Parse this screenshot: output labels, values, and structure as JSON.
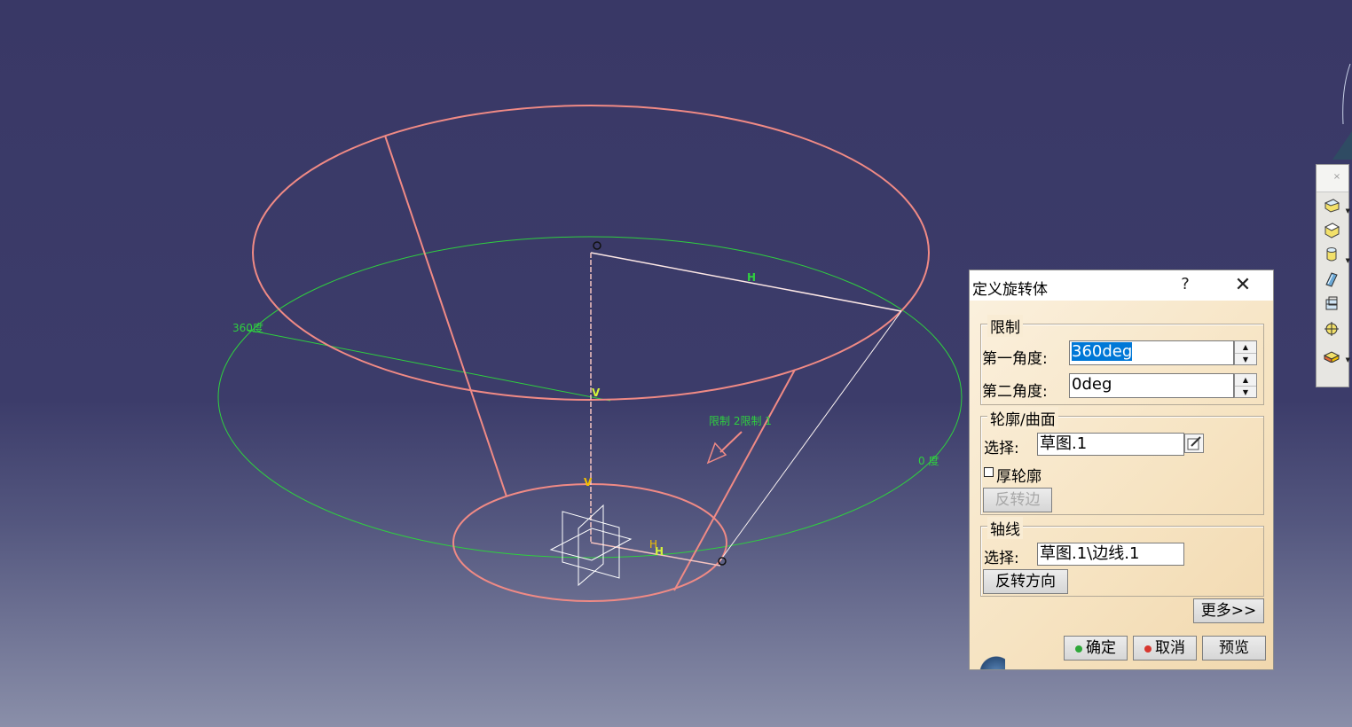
{
  "dialog": {
    "title": "定义旋转体",
    "help": "?",
    "close": "✕",
    "limits": {
      "title": "限制",
      "first_angle_label": "第一角度:",
      "first_angle_value": "360deg",
      "second_angle_label": "第二角度:",
      "second_angle_value": "0deg"
    },
    "profile": {
      "title": "轮廓/曲面",
      "select_label": "选择:",
      "select_value": "草图.1",
      "thick_profile_label": "厚轮廓",
      "reverse_side_label": "反转边"
    },
    "axis": {
      "title": "轴线",
      "select_label": "选择:",
      "select_value": "草图.1\\边线.1",
      "reverse_direction_label": "反转方向"
    },
    "more_label": "更多>>",
    "ok_label": "确定",
    "cancel_label": "取消",
    "preview_label": "预览"
  },
  "viewport": {
    "annotation_360": "360度",
    "annotation_0": "0 度",
    "annotation_limits": "限制 2限制 1",
    "marker_h": "H",
    "marker_v": "V"
  },
  "toolbar": {
    "close": "×",
    "items": [
      "pad-icon",
      "pocket-icon",
      "shaft-icon",
      "rib-icon",
      "multi-section-icon",
      "hole-icon",
      "stiffener-icon"
    ]
  },
  "colors": {
    "background_top": "#393866",
    "background_bottom": "#8a8fa9",
    "geometry_red": "#f08a85",
    "limit_green": "#2fcf3f",
    "dialog_bg": "#f6e3c1",
    "selection_blue": "#0078d7"
  }
}
